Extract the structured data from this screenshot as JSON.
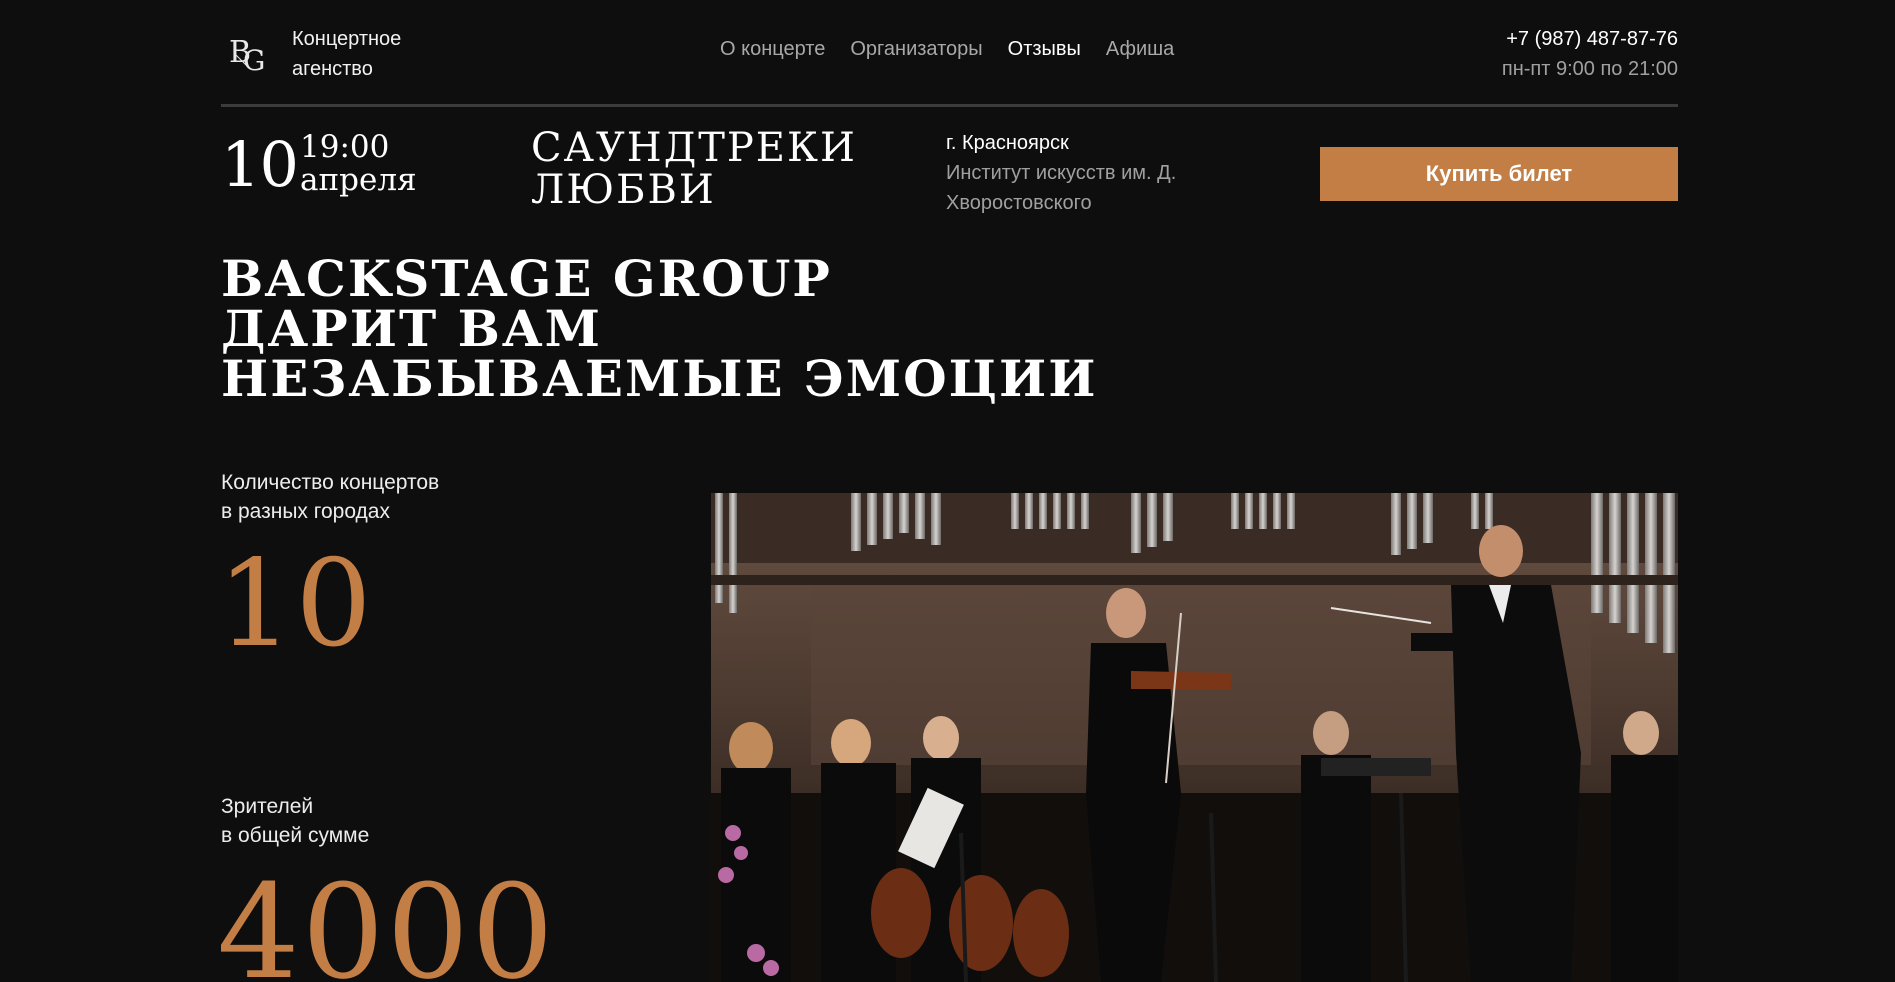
{
  "header": {
    "logo_text": "BG",
    "brand_line1": "Концертное",
    "brand_line2": "агенство",
    "nav": [
      {
        "label": "О концерте",
        "active": false
      },
      {
        "label": "Организаторы",
        "active": false
      },
      {
        "label": "Отзывы",
        "active": true
      },
      {
        "label": "Афиша",
        "active": false
      }
    ],
    "phone": "+7 (987) 487-87-76",
    "hours": "пн-пт 9:00 по 21:00"
  },
  "event": {
    "day": "10",
    "time": "19:00",
    "month": "апреля",
    "title_line1": "САУНДТРЕКИ",
    "title_line2": "ЛЮБВИ",
    "city": "г. Красноярск",
    "venue_line1": "Институт искусств им. Д.",
    "venue_line2": "Хворостовского",
    "buy_label": "Купить билет"
  },
  "headline": {
    "line1": "BACKSTAGE GROUP",
    "line2": "ДАРИТ ВАМ",
    "line3": "НЕЗАБЫВАЕМЫЕ ЭМОЦИИ"
  },
  "stats": [
    {
      "label_line1": "Количество концертов",
      "label_line2": "в разных городах",
      "value": "10"
    },
    {
      "label_line1": "Зрителей",
      "label_line2": "в общей сумме",
      "value": "4000"
    }
  ],
  "colors": {
    "background": "#0f0e0e",
    "accent": "#c37e45",
    "muted_text": "#a0a0a0"
  }
}
